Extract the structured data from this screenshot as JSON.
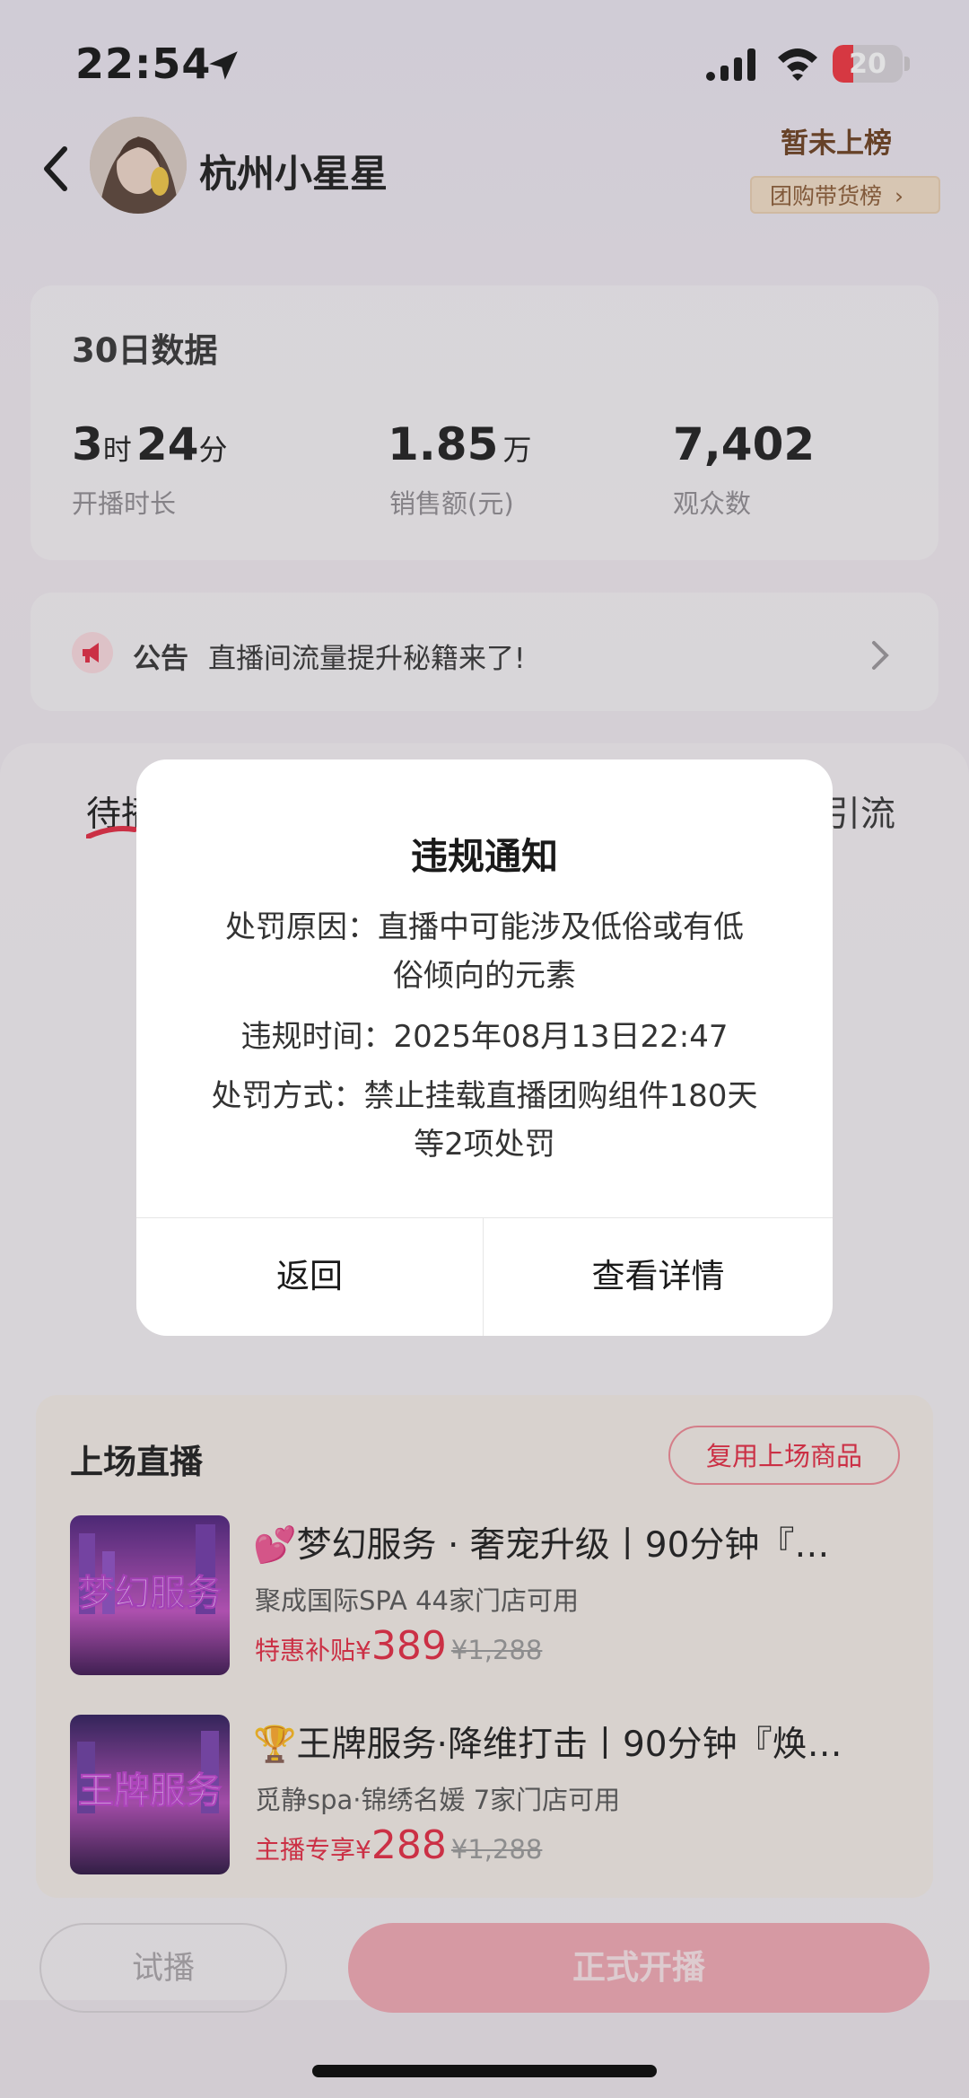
{
  "status_bar": {
    "time": "22:54",
    "battery": "20",
    "battery_color": "#f2313c"
  },
  "header": {
    "username": "杭州小星星",
    "rank_status": "暂未上榜",
    "rank_tag": "团购带货榜"
  },
  "stats": {
    "title": "30日数据",
    "items": [
      {
        "hours": "3",
        "hours_unit": "时",
        "minutes": "24",
        "minutes_unit": "分",
        "label": "开播时长"
      },
      {
        "value": "1.85",
        "unit": "万",
        "label": "销售额(元)"
      },
      {
        "value": "7,402",
        "label": "观众数"
      }
    ]
  },
  "notice": {
    "label": "公告",
    "text": "直播间流量提升秘籍来了!"
  },
  "tabs": {
    "left_partial": "待播",
    "right_partial": "引流"
  },
  "live_section": {
    "title": "上场直播",
    "reuse_button": "复用上场商品",
    "products": [
      {
        "title": "💕梦幻服务 · 奢宠升级丨90分钟『…",
        "subtitle": "聚成国际SPA 44家门店可用",
        "price_tag": "特惠补贴¥",
        "price": "389",
        "original_price": "¥1,288",
        "thumb_text": "梦幻服务"
      },
      {
        "title": "🏆王牌服务·降维打击丨90分钟『焕…",
        "subtitle": "觅静spa·锦绣名媛 7家门店可用",
        "price_tag": "主播专享¥",
        "price": "288",
        "original_price": "¥1,288",
        "thumb_text": "王牌服务"
      }
    ]
  },
  "bottom": {
    "trial_button": "试播",
    "start_button": "正式开播"
  },
  "dialog": {
    "title": "违规通知",
    "reason_line1": "处罚原因：直播中可能涉及低俗或有低",
    "reason_line2": "俗倾向的元素",
    "time_line": "违规时间：2025年08月13日22:47",
    "method_line1": "处罚方式：禁止挂载直播团购组件180天",
    "method_line2": "等2项处罚",
    "back_button": "返回",
    "detail_button": "查看详情"
  },
  "colors": {
    "accent": "#e52840",
    "start_button": "#f2a8b3",
    "rank_text": "#6b3e1d"
  }
}
